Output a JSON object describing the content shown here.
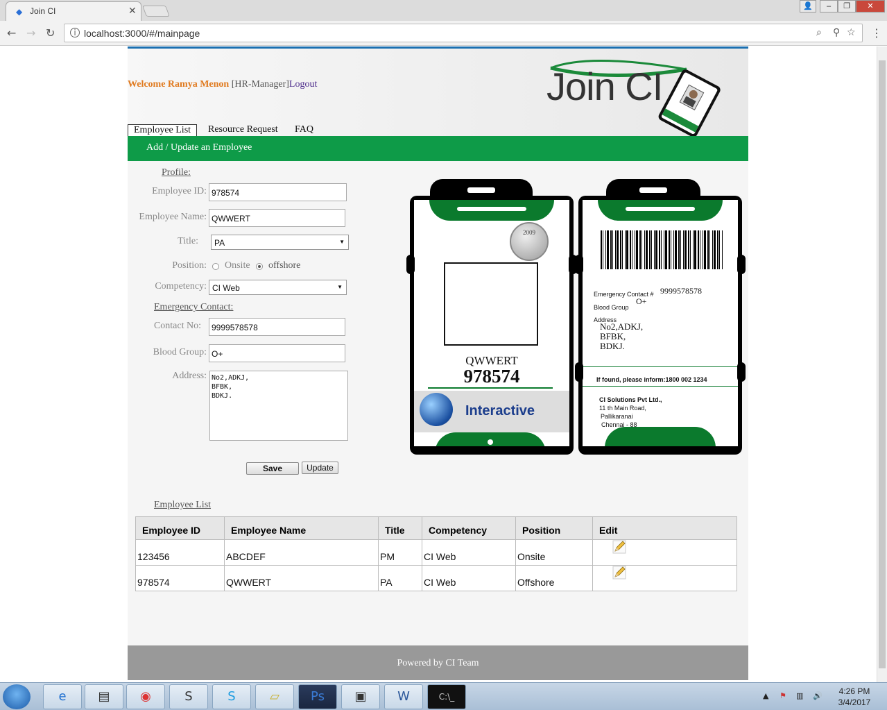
{
  "browser": {
    "tab_title": "Join CI",
    "url": "localhost:3000/#/mainpage",
    "info_icon": "i"
  },
  "header": {
    "welcome_prefix": "Welcome",
    "user_name": "Ramya Menon",
    "role": "[HR-Manager]",
    "logout": "Logout",
    "logo_text": "Join CI"
  },
  "nav": {
    "tabs": [
      "Employee List",
      "Resource Request",
      "FAQ"
    ],
    "active": "Employee List"
  },
  "section_bar": "Add / Update an Employee",
  "form": {
    "profile_heading": "Profile:",
    "employee_id_label": "Employee ID:",
    "employee_id": "978574",
    "employee_name_label": "Employee Name:",
    "employee_name": "QWWERT",
    "title_label": "Title:",
    "title": "PA",
    "position_label": "Position:",
    "position_options": [
      "Onsite",
      "offshore"
    ],
    "position_selected": "offshore",
    "competency_label": "Competency:",
    "competency": "CI Web",
    "emergency_heading": "Emergency Contact:",
    "contact_label": "Contact No:",
    "contact_no": "9999578578",
    "blood_label": "Blood Group:",
    "blood_group": "O+",
    "address_label": "Address:",
    "address": "No2,ADKJ,\nBFBK,\nBDKJ.",
    "save": "Save",
    "update": "Update"
  },
  "id_card_front": {
    "name": "QWWERT",
    "id": "978574",
    "seal_year": "2009",
    "brand": "Interactive"
  },
  "id_card_back": {
    "emergency_label": "Emergency Contact #",
    "emergency_no": "9999578578",
    "blood_label": "Blood Group",
    "blood_value": "O+",
    "address_label": "Address",
    "address_lines": [
      "No2,ADKJ,",
      "BFBK,",
      "BDKJ."
    ],
    "found_text": "If found, please inform:1800 002 1234",
    "company": "CI Solutions Pvt Ltd.,",
    "company_lines": [
      "11 th Main Road,",
      "Pallikaranai",
      "Chennai - 88"
    ]
  },
  "employee_list": {
    "title": "Employee List",
    "columns": [
      "Employee ID",
      "Employee Name",
      "Title",
      "Competency",
      "Position",
      "Edit"
    ],
    "rows": [
      [
        "123456",
        "ABCDEF",
        "PM",
        "CI Web",
        "Onsite"
      ],
      [
        "978574",
        "QWWERT",
        "PA",
        "CI Web",
        "Offshore"
      ]
    ]
  },
  "footer": "Powered by CI Team",
  "taskbar": {
    "time": "4:26 PM",
    "date": "3/4/2017"
  },
  "colors": {
    "green": "#0e9b48",
    "welcome_orange": "#e07a1f",
    "link_purple": "#4b2a8a",
    "footer_gray": "#999999"
  }
}
